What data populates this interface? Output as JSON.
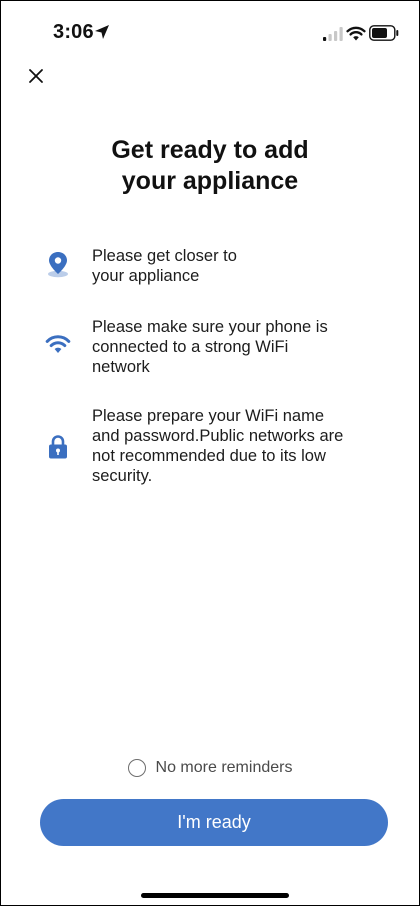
{
  "status_bar": {
    "time": "3:06",
    "location_icon": "location-arrow-icon",
    "signal_icon": "cellular-signal-icon",
    "wifi_icon": "wifi-icon",
    "battery_icon": "battery-icon"
  },
  "header": {
    "close_icon": "close-icon"
  },
  "title": {
    "line1": "Get ready to add",
    "line2": "your appliance"
  },
  "tips": [
    {
      "icon": "location-pin-icon",
      "lines": [
        "Please get closer to",
        "your appliance"
      ]
    },
    {
      "icon": "wifi-icon",
      "lines": [
        "Please make sure your phone is",
        "connected to a strong WiFi",
        "network"
      ]
    },
    {
      "icon": "lock-icon",
      "lines": [
        "Please prepare your WiFi name",
        "and password.Public networks are",
        "not recommended due to its low",
        "security."
      ]
    }
  ],
  "reminder": {
    "label": "No more reminders",
    "checked": false
  },
  "cta": {
    "label": "I'm ready"
  },
  "colors": {
    "accent": "#4277c8",
    "icon_blue": "#3b6fc0",
    "text": "#1c1c1c",
    "muted": "#4a4a4a"
  }
}
